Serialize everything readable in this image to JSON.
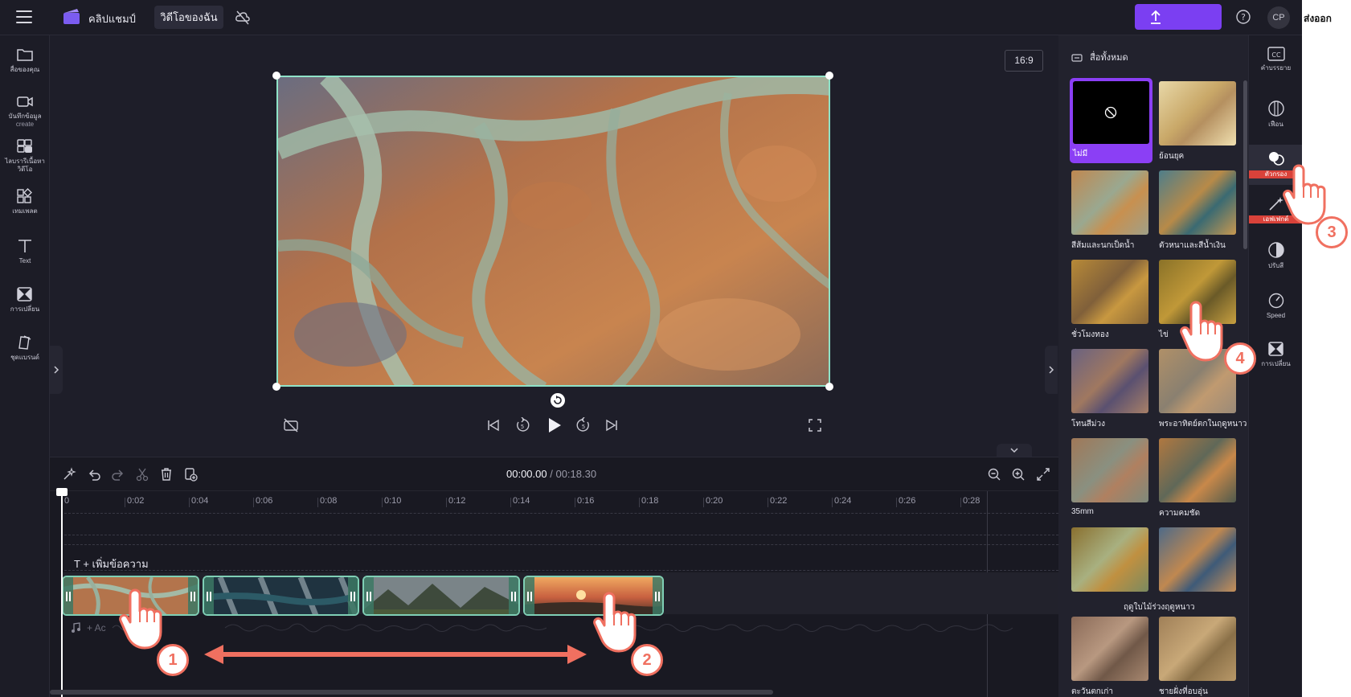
{
  "app": {
    "name": "คลิปแชมป์",
    "my_video_tab": "วิดีโอของฉัน",
    "avatar_initials": "CP",
    "corner_text": "ส่งออก",
    "accent_color": "#7b3ff2"
  },
  "left_sidebar": {
    "items": [
      {
        "label": "สื่อของคุณ",
        "icon": "folder-icon"
      },
      {
        "label": "บันทึกข้อมูล",
        "sublabel": "create",
        "icon": "camera-icon"
      },
      {
        "label": "ไลบรารีเนื้อหา",
        "sublabel": "วิดีโอ",
        "icon": "library-icon"
      },
      {
        "label": "เทมเพลต",
        "icon": "templates-icon"
      },
      {
        "label": "Text",
        "icon": "text-icon"
      },
      {
        "label": "การเปลี่ยน",
        "icon": "transitions-icon"
      },
      {
        "label": "ชุดแบรนด์",
        "icon": "brand-kit-icon"
      }
    ]
  },
  "preview": {
    "aspect_ratio": "16:9"
  },
  "timeline": {
    "current_time": "00:00.00",
    "total_time": "/ 00:18.30",
    "ticks": [
      "0",
      "0:02",
      "0:04",
      "0:06",
      "0:08",
      "0:10",
      "0:12",
      "0:14",
      "0:16",
      "0:18",
      "0:20",
      "0:22",
      "0:24",
      "0:26",
      "0:28"
    ],
    "add_text_label": "T + เพิ่มข้อความ",
    "add_audio_label": "+ Ac"
  },
  "filters_panel": {
    "header": "สื่อทั้งหมด",
    "filters": [
      {
        "label": "ไม่มี",
        "selected": true
      },
      {
        "label": "ย้อนยุค"
      },
      {
        "label": "สีส้มและนกเป็ดน้ำ"
      },
      {
        "label": "ตัวหนาและสีน้ำเงิน"
      },
      {
        "label": "ชั่วโมงทอง"
      },
      {
        "label": "ไข่"
      },
      {
        "label": "โทนสีม่วง"
      },
      {
        "label": "พระอาทิตย์ตกในฤดูหนาว"
      },
      {
        "label": "35mm"
      },
      {
        "label": "ความคมชัด"
      },
      {
        "label": "ฤดูใบไม้ร่วงฤดูหนาว"
      },
      {
        "label": ""
      },
      {
        "label": "ตะวันตกเก่า"
      },
      {
        "label": "ชายฝั่งที่อบอุ่น"
      }
    ]
  },
  "right_rail": {
    "items": [
      {
        "label": "คำบรรยาย",
        "icon": "captions-icon"
      },
      {
        "label": "เฟือน",
        "icon": "fade-icon"
      },
      {
        "label": "ตัวกรอง",
        "icon": "filters-icon",
        "active": true
      },
      {
        "label": "เอฟเฟกต์",
        "icon": "effects-icon"
      },
      {
        "label": "ปรับสี",
        "icon": "adjust-color-icon"
      },
      {
        "label": "Speed",
        "icon": "speed-icon"
      },
      {
        "label": "การเปลี่ยน",
        "icon": "transition-icon"
      }
    ]
  },
  "annotations": {
    "steps": [
      "1",
      "2",
      "3",
      "4"
    ],
    "color": "#f07060"
  }
}
